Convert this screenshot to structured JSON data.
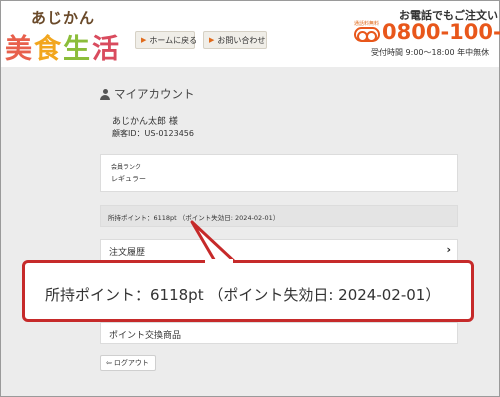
{
  "header": {
    "logo_small": "あじかん",
    "logo_chars": [
      "美",
      "食",
      "生",
      "活"
    ],
    "nav": [
      {
        "label": "ホームに戻る"
      },
      {
        "label": "お問い合わせ"
      }
    ],
    "tel_title": "お電話でもご注文い",
    "tel_free_label": "通話料無料",
    "tel_number": "0800-100-",
    "tel_hours": "受付時間 9:00～18:00 年中無休"
  },
  "account": {
    "title": "マイアカウント",
    "user_name": "あじかん太郎 様",
    "customer_id": "顧客ID：US-0123456",
    "rank_label": "会員ランク",
    "rank_value": "レギュラー",
    "points_text": "所持ポイント：6118pt （ポイント失効日: 2024-02-01）",
    "menu": {
      "history": "注文履歴",
      "exchange": "ポイント交換商品"
    },
    "logout": "ログアウト"
  },
  "callout": {
    "text": "所持ポイント：6118pt （ポイント失効日: 2024-02-01）"
  },
  "colors": {
    "accent": "#e8571b",
    "callout_border": "#c62a2a"
  }
}
